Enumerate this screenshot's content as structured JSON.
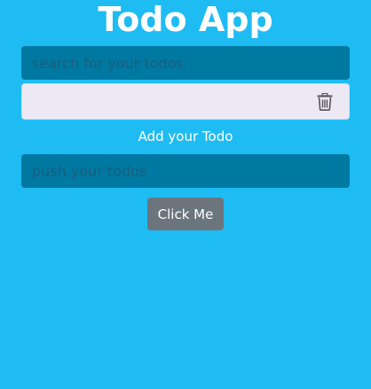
{
  "app": {
    "title": "Todo App"
  },
  "search": {
    "placeholder": "search for your todos",
    "value": ""
  },
  "todos": [
    {
      "text": "",
      "delete_icon": "trash-icon"
    }
  ],
  "add": {
    "label": "Add your Todo",
    "placeholder": "push your todos",
    "value": "",
    "button_label": "Click Me"
  },
  "colors": {
    "background": "#1fbcf4",
    "input_background": "#0079a2",
    "todo_background": "#ece9f5",
    "button_background": "#6c757d"
  }
}
